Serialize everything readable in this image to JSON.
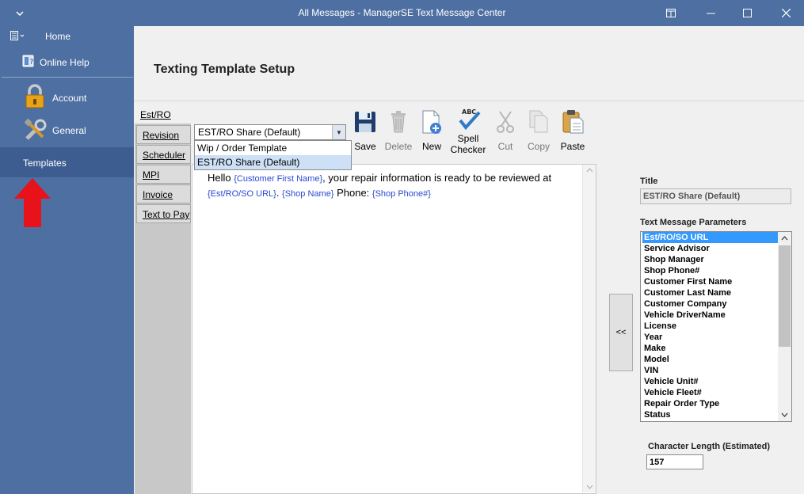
{
  "window": {
    "title": "All Messages - ManagerSE Text Message Center"
  },
  "sidebar": {
    "home": "Home",
    "online_help": "Online Help",
    "items": [
      {
        "label": "Account",
        "icon": "padlock-icon"
      },
      {
        "label": "General",
        "icon": "tools-icon"
      },
      {
        "label": "Templates"
      }
    ]
  },
  "main": {
    "page_title": "Texting Template Setup",
    "section_label": "Est/RO",
    "tabs": [
      "Revision",
      "Scheduler",
      "MPI",
      "Invoice",
      "Text to Pay"
    ],
    "template_combo": {
      "selected": "EST/RO Share (Default)",
      "options": [
        "Wip / Order Template",
        "EST/RO Share (Default)"
      ]
    },
    "toolbar": {
      "save": "Save",
      "delete": "Delete",
      "new": "New",
      "spell_checker": "Spell\nChecker",
      "spell_abc": "ABC",
      "cut": "Cut",
      "copy": "Copy",
      "paste": "Paste"
    },
    "editor": {
      "t1": "Hello ",
      "p1": "{Customer First Name}",
      "t2": ", your repair information is ready to be reviewed at",
      "p2": "{Est/RO/SO URL}",
      "t3": ". ",
      "p3": "{Shop Name}",
      "t4": " Phone: ",
      "p4": "{Shop Phone#}"
    }
  },
  "right_panel": {
    "title_label": "Title",
    "title_value": "EST/RO Share (Default)",
    "params_label": "Text Message Parameters",
    "params": [
      "Est/RO/SO URL",
      "Service Advisor",
      "Shop Manager",
      "Shop Phone#",
      "Customer First Name",
      "Customer Last Name",
      "Customer Company",
      "Vehicle DriverName",
      "License",
      "Year",
      "Make",
      "Model",
      "VIN",
      "Vehicle Unit#",
      "Vehicle Fleet#",
      "Repair Order Type",
      "Status"
    ],
    "selected_param": "Est/RO/SO URL",
    "insert_button": "<<",
    "char_length_label": "Character Length (Estimated)",
    "char_length_value": "157"
  },
  "colors": {
    "sidebar_bg": "#4e6fa1",
    "sidebar_selected": "#3d5d91",
    "param_token": "#2a4ad0",
    "selection": "#3399ff",
    "arrow": "#e8121b"
  }
}
